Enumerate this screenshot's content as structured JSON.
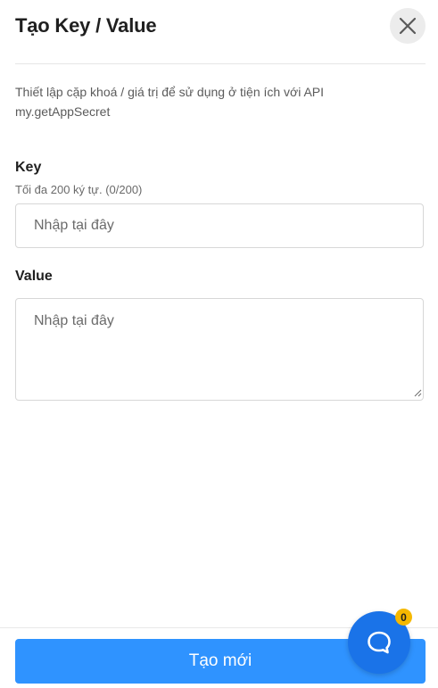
{
  "dialog": {
    "title": "Tạo Key / Value",
    "description": "Thiết lập cặp khoá / giá trị để sử dụng ở tiện ích với API my.getAppSecret",
    "close_icon": "close-icon"
  },
  "key_field": {
    "label": "Key",
    "hint": "Tối đa 200 ký tự. (0/200)",
    "value": "",
    "placeholder": "Nhập tại đây"
  },
  "value_field": {
    "label": "Value",
    "value": "",
    "placeholder": "Nhập tại đây"
  },
  "footer": {
    "submit_label": "Tạo mới"
  },
  "chat_widget": {
    "icon": "chat-bubble-icon",
    "badge_count": "0",
    "color": "#1a73e8",
    "badge_color": "#f5b800"
  },
  "colors": {
    "primary_button": "#2f93ff"
  }
}
